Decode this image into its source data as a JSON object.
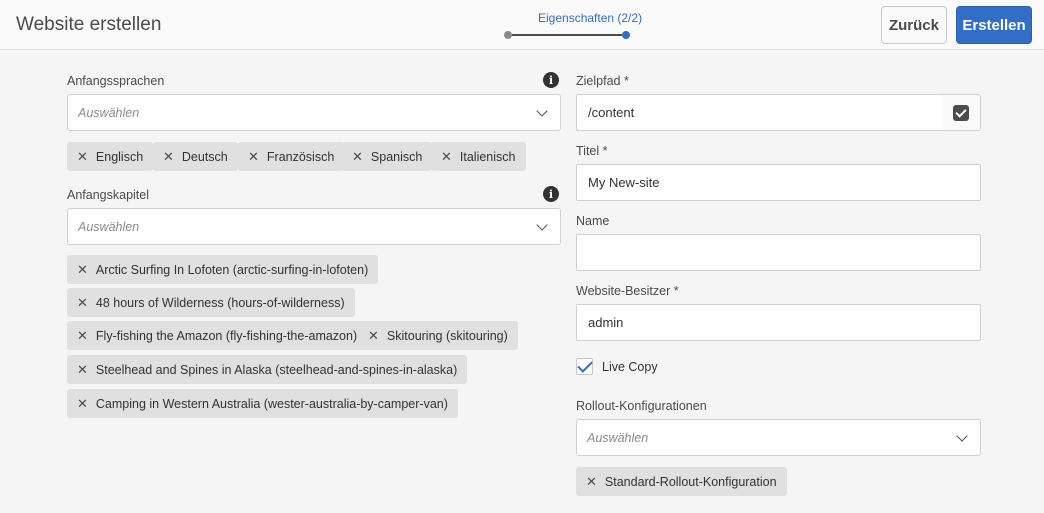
{
  "header": {
    "title": "Website erstellen",
    "step_label": "Eigenschaften (2/2)",
    "back_label": "Zurück",
    "create_label": "Erstellen"
  },
  "left": {
    "languages_label": "Anfangssprachen",
    "languages_placeholder": "Auswählen",
    "languages": [
      "Englisch",
      "Deutsch",
      "Französisch",
      "Spanisch",
      "Italienisch"
    ],
    "chapters_label": "Anfangskapitel",
    "chapters_placeholder": "Auswählen",
    "chapters": [
      "Arctic Surfing In Lofoten (arctic-surfing-in-lofoten)",
      "48 hours of Wilderness (hours-of-wilderness)",
      "Fly-fishing the Amazon (fly-fishing-the-amazon)",
      "Skitouring (skitouring)",
      "Steelhead and Spines in Alaska (steelhead-and-spines-in-alaska)",
      "Camping in Western Australia (wester-australia-by-camper-van)"
    ],
    "info_icon": "i"
  },
  "right": {
    "target_path_label": "Zielpfad *",
    "target_path_value": "/content",
    "title_label": "Titel *",
    "title_value": "My New-site",
    "name_label": "Name",
    "name_value": "",
    "owner_label": "Website-Besitzer *",
    "owner_value": "admin",
    "live_copy_label": "Live Copy",
    "live_copy_checked": true,
    "rollout_label": "Rollout-Konfigurationen",
    "rollout_placeholder": "Auswählen",
    "rollout_tags": [
      "Standard-Rollout-Konfiguration"
    ]
  },
  "tag_remove_glyph": "✕",
  "colors": {
    "accent": "#326ec8",
    "background": "#f5f5f5",
    "tag_bg": "#e0e0e0"
  }
}
